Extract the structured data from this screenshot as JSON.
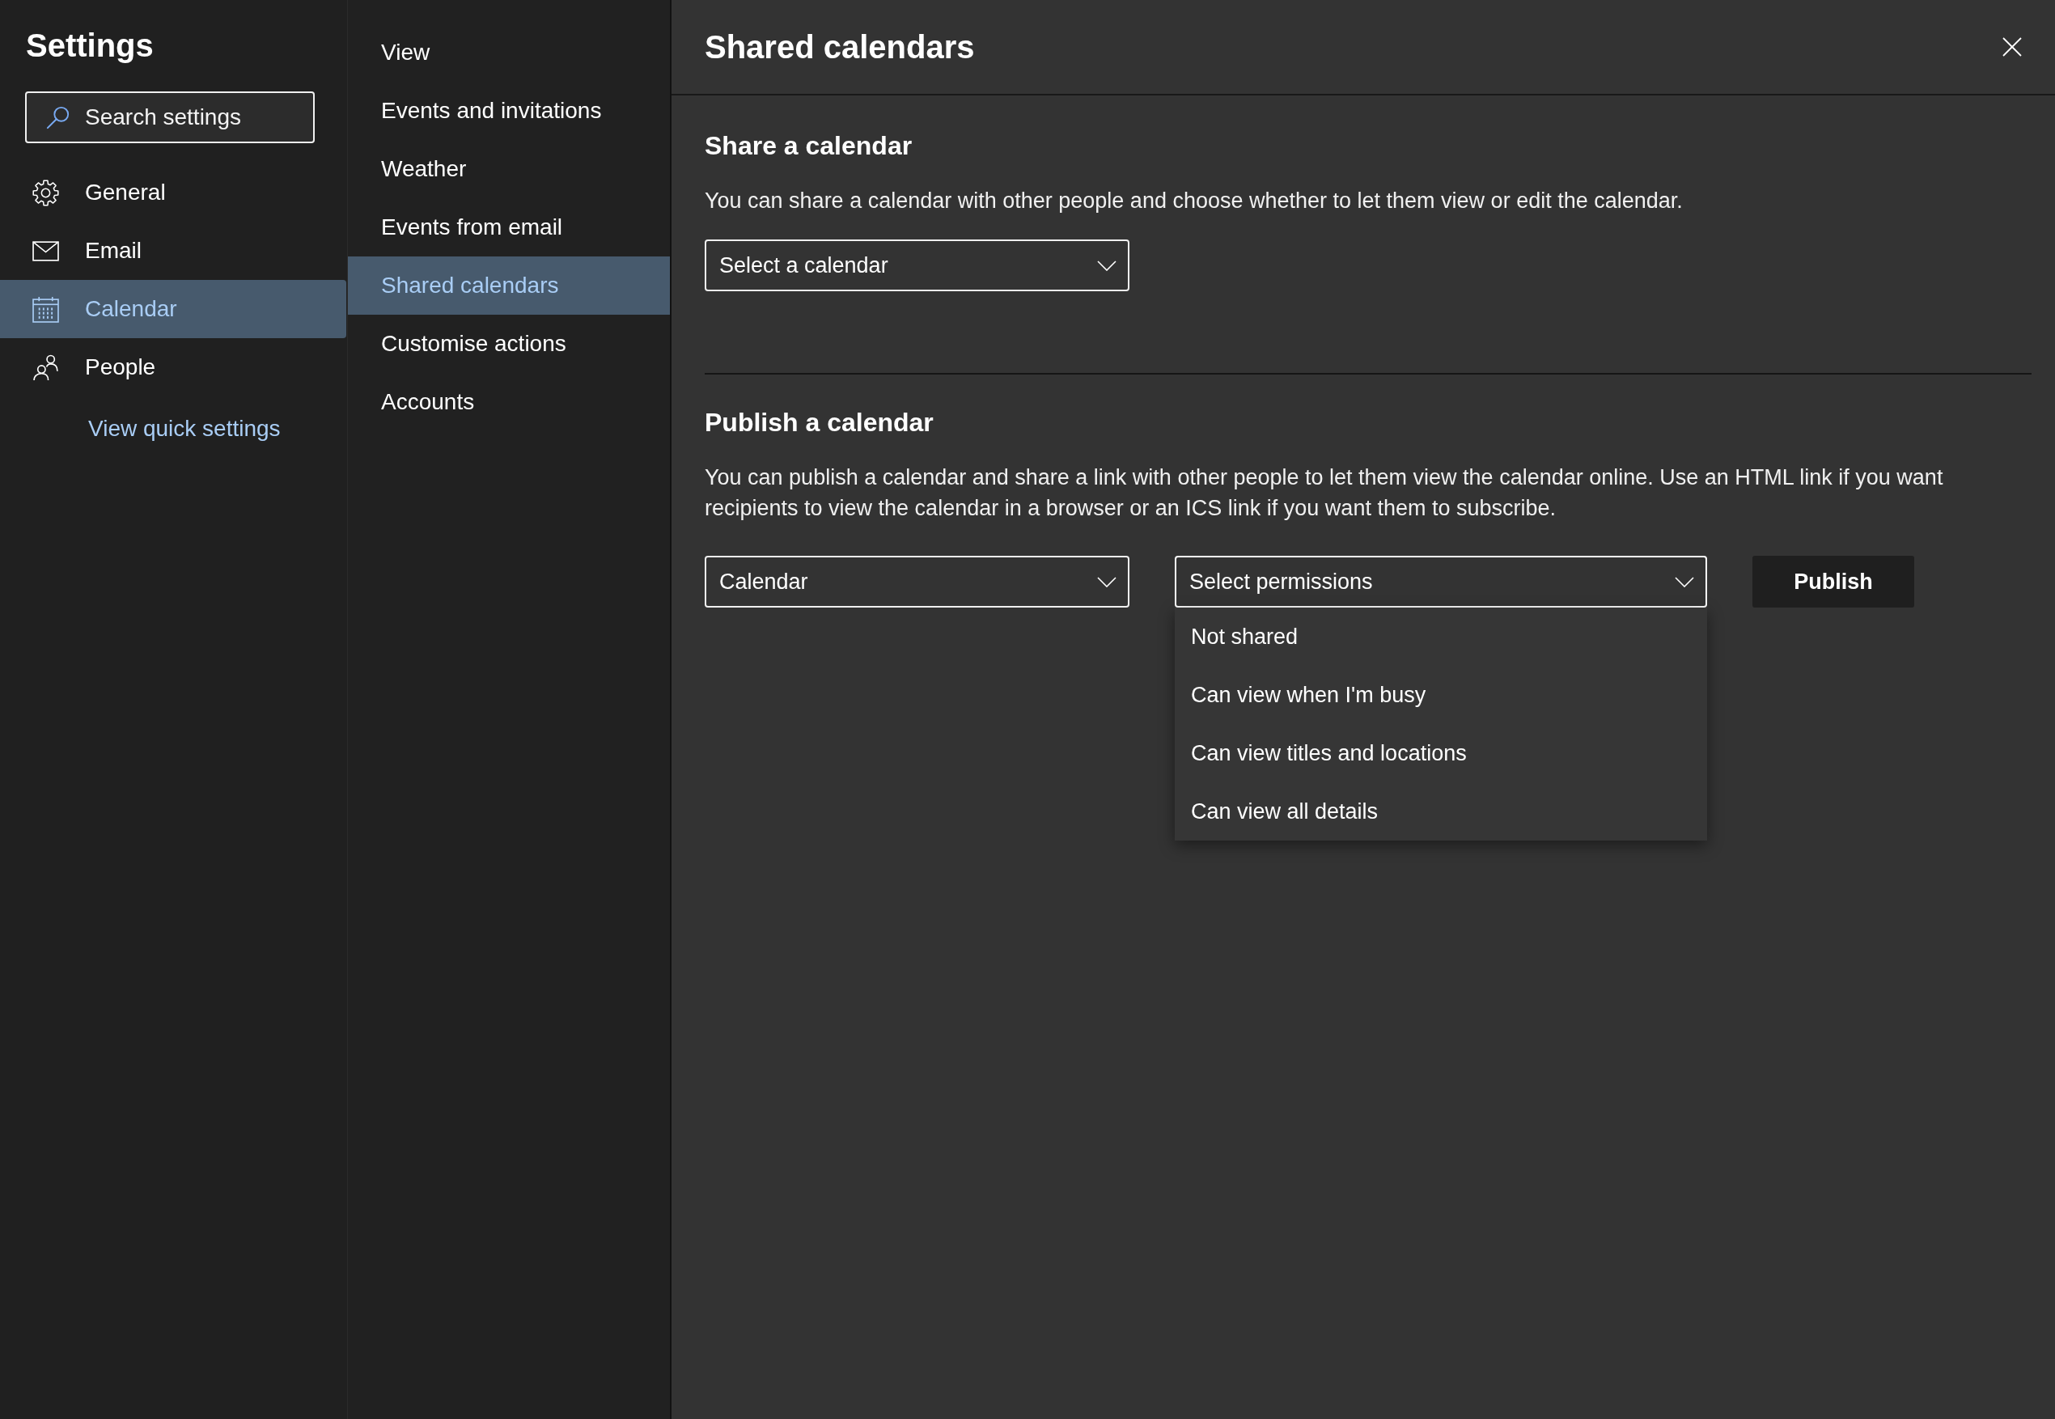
{
  "settings_nav": {
    "title": "Settings",
    "search": {
      "placeholder": "Search settings"
    },
    "categories": [
      {
        "label": "General",
        "selected": false
      },
      {
        "label": "Email",
        "selected": false
      },
      {
        "label": "Calendar",
        "selected": true
      },
      {
        "label": "People",
        "selected": false
      }
    ],
    "quick_settings_link": "View quick settings"
  },
  "calendar_nav": {
    "items": [
      {
        "label": "View",
        "selected": false
      },
      {
        "label": "Events and invitations",
        "selected": false
      },
      {
        "label": "Weather",
        "selected": false
      },
      {
        "label": "Events from email",
        "selected": false
      },
      {
        "label": "Shared calendars",
        "selected": true
      },
      {
        "label": "Customise actions",
        "selected": false
      },
      {
        "label": "Accounts",
        "selected": false
      }
    ]
  },
  "panel": {
    "title": "Shared calendars",
    "sections": [
      {
        "heading": "Share a calendar",
        "description": "You can share a calendar with other people and choose whether to let them view or edit the calendar.",
        "controls": [
          {
            "kind": "dropdown",
            "value": "Select a calendar"
          }
        ]
      },
      {
        "heading": "Publish a calendar",
        "description": "You can publish a calendar and share a link with other people to let them view the calendar online. Use an HTML link if you want recipients to view the calendar in a browser or an ICS link if you want them to subscribe.",
        "controls": [
          {
            "kind": "dropdown",
            "value": "Calendar"
          },
          {
            "kind": "dropdown",
            "value": "Select permissions",
            "expanded": true,
            "options": [
              {
                "label": "Not shared",
                "selected": false
              },
              {
                "label": "Can view when I'm busy",
                "selected": false
              },
              {
                "label": "Can view titles and locations",
                "selected": false
              },
              {
                "label": "Can view all details",
                "selected": false
              }
            ]
          },
          {
            "kind": "button",
            "label": "Publish"
          }
        ]
      }
    ]
  }
}
